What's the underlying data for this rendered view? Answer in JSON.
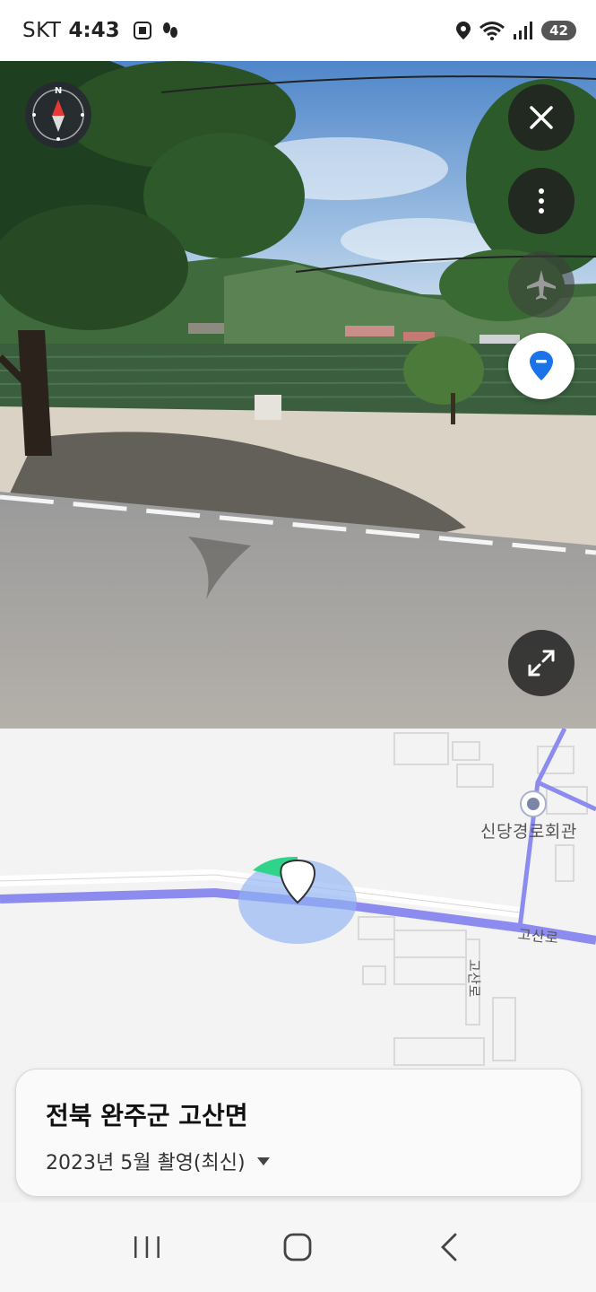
{
  "status_bar": {
    "carrier": "SKT",
    "time": "4:43",
    "battery": "42"
  },
  "street_view": {
    "compass_letter": "N",
    "buttons": [
      "close-icon",
      "more-vertical-icon",
      "airplane-icon",
      "location-pin-icon",
      "expand-icon"
    ]
  },
  "map": {
    "poi_label": "신당경로회관",
    "road_main": "고산로",
    "road_side": "고산로"
  },
  "info_card": {
    "address": "전북 완주군 고산면",
    "capture_date": "2023년 5월 촬영(최신)"
  },
  "colors": {
    "accent_blue": "#1a73e8",
    "road_blue": "#8c8cf0",
    "view_cone": "#2fd38a"
  }
}
